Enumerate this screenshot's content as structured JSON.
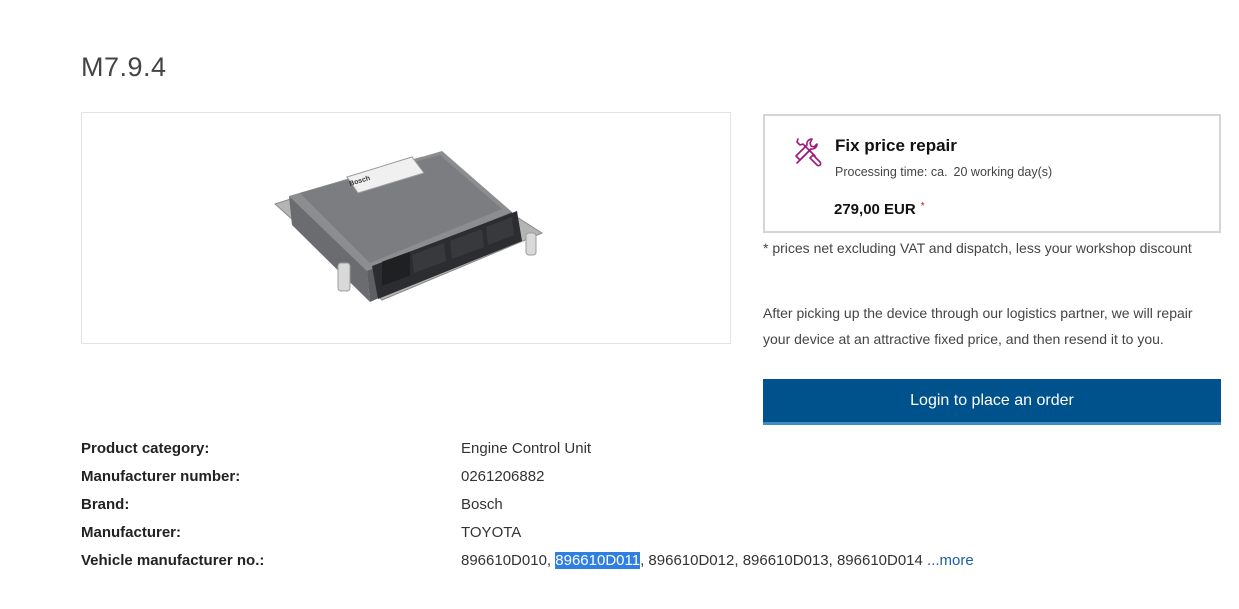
{
  "page": {
    "title": "M7.9.4"
  },
  "product_image": {
    "label_text": "Bosch"
  },
  "repair_card": {
    "title": "Fix price repair",
    "processing_label": "Processing time: ca.",
    "processing_value": "20 working day(s)",
    "price": "279,00 EUR",
    "price_marker": "*",
    "icon": "tools-icon",
    "icon_color": "#a1197a"
  },
  "notes": {
    "vat": "* prices net excluding VAT and dispatch, less your workshop discount",
    "description": "After picking up the device through our logistics partner, we will repair your device at an attractive fixed price, and then resend it to you."
  },
  "login_button": {
    "label": "Login to place an order",
    "color": "#00528c"
  },
  "details": [
    {
      "label": "Product category:",
      "value": "Engine Control Unit"
    },
    {
      "label": "Manufacturer number:",
      "value": "0261206882"
    },
    {
      "label": "Brand:",
      "value": "Bosch"
    },
    {
      "label": "Manufacturer:",
      "value": "TOYOTA"
    }
  ],
  "vehicle_numbers": {
    "label": "Vehicle manufacturer no.:",
    "items": [
      "896610D010",
      "896610D011",
      "896610D012",
      "896610D013",
      "896610D014"
    ],
    "selected": "896610D011",
    "more_label": "...more"
  }
}
